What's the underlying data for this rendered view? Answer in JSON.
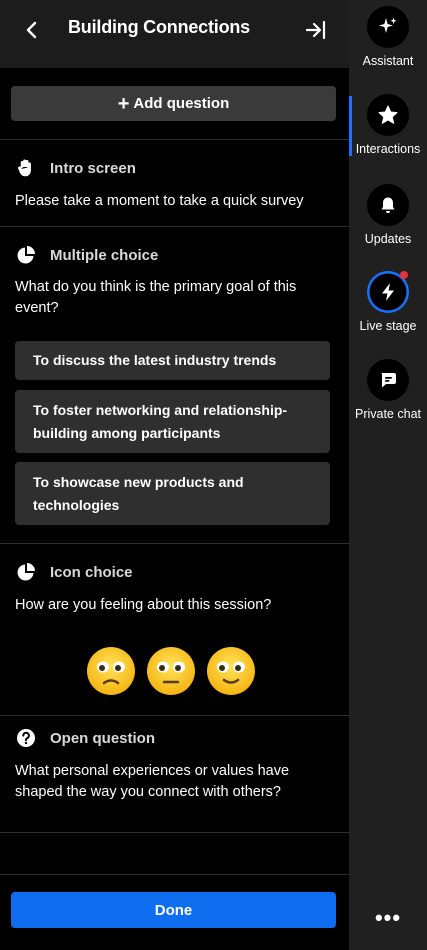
{
  "header": {
    "title": "Building Connections"
  },
  "toolbar": {
    "add_question_label": "Add question",
    "done_label": "Done"
  },
  "questions": [
    {
      "type_label": "Intro screen",
      "text": "Please take a moment to take a quick survey",
      "icon": "wave-icon"
    },
    {
      "type_label": "Multiple choice",
      "text": "What do you think is the primary goal of this event?",
      "icon": "pie-chart-icon",
      "options": [
        "To discuss the latest industry trends",
        "To foster networking and relationship-building among participants",
        "To showcase new products and technologies"
      ]
    },
    {
      "type_label": "Icon choice",
      "text": "How are you feeling about this session?",
      "icon": "pie-chart-icon",
      "emojis": [
        "unhappy-face-icon",
        "neutral-face-icon",
        "happy-face-icon"
      ]
    },
    {
      "type_label": "Open question",
      "text": "What personal experiences or values have shaped the way you connect with others?",
      "icon": "question-icon"
    }
  ],
  "sidebar": {
    "items": [
      {
        "label": "Assistant",
        "icon": "sparkle-icon"
      },
      {
        "label": "Interactions",
        "icon": "star-icon",
        "active": true
      },
      {
        "label": "Updates",
        "icon": "bell-icon"
      },
      {
        "label": "Live stage",
        "icon": "lightning-icon",
        "notification": true
      },
      {
        "label": "Private chat",
        "icon": "chat-icon"
      }
    ],
    "more_label": "•••"
  },
  "colors": {
    "accent": "#0f6ef0",
    "active_bar": "#1a73ff",
    "notification": "#e8313c",
    "option_bg": "#2f2f2f"
  }
}
